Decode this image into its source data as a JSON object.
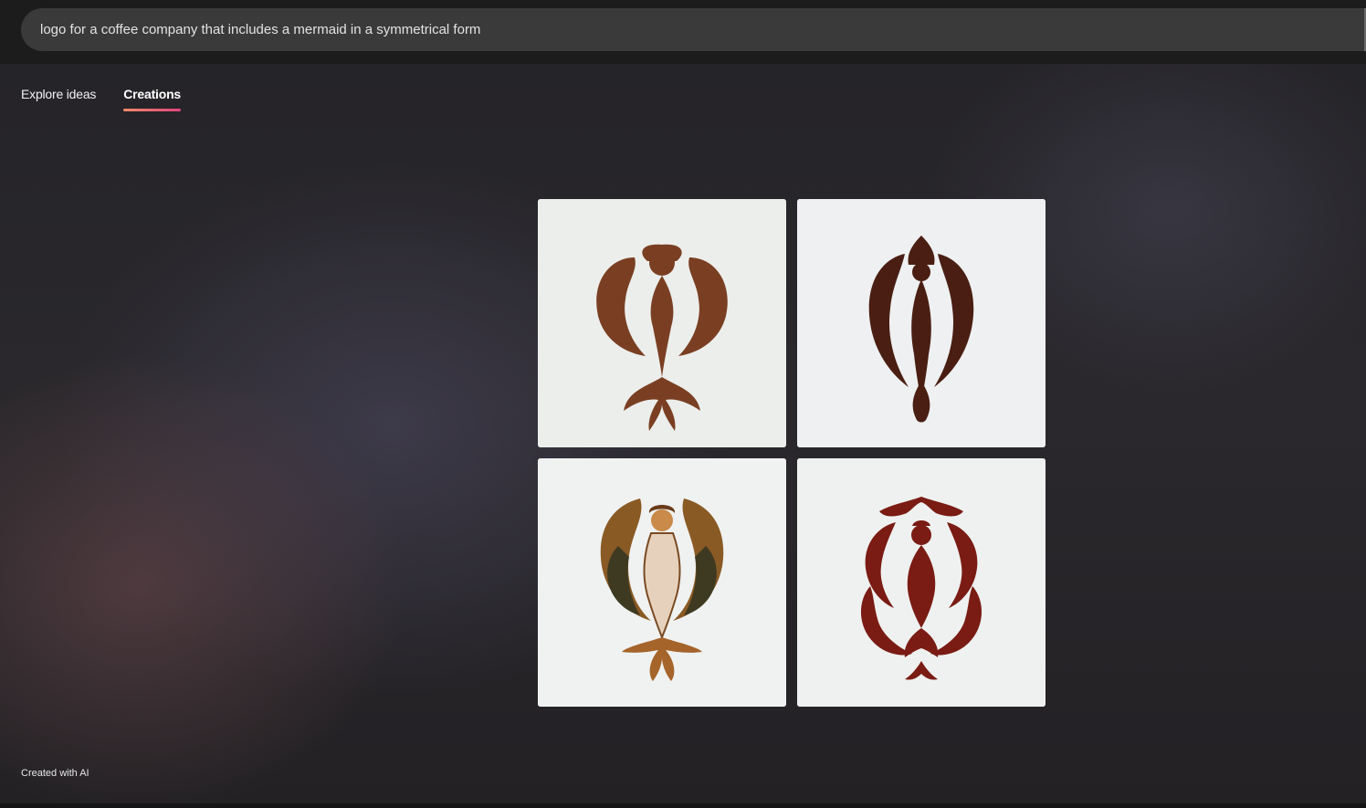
{
  "search": {
    "query": "logo for a coffee company that includes a mermaid in a symmetrical form"
  },
  "tabs": [
    {
      "label": "Explore ideas",
      "active": false
    },
    {
      "label": "Creations",
      "active": true
    }
  ],
  "images": [
    {
      "name": "mermaid-logo-1",
      "colors": {
        "fill": "#7a3f22",
        "bg": "#eceeec"
      }
    },
    {
      "name": "mermaid-logo-2",
      "colors": {
        "fill": "#4a1e12",
        "bg": "#eef0f1"
      }
    },
    {
      "name": "mermaid-logo-3",
      "colors": {
        "fill": "#a0602a",
        "bg": "#f0f2f1"
      }
    },
    {
      "name": "mermaid-logo-4",
      "colors": {
        "fill": "#7a1c14",
        "bg": "#eff1f0"
      }
    }
  ],
  "footer": {
    "text": "Created with AI"
  }
}
